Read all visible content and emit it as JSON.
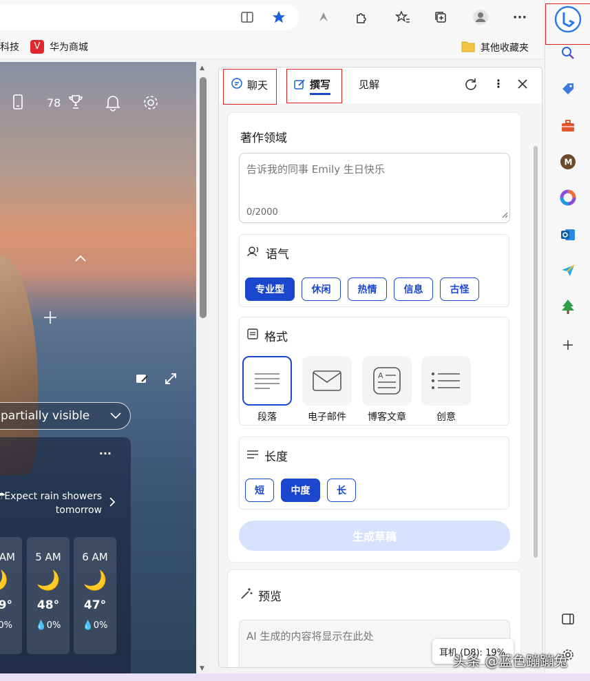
{
  "bookmarks": {
    "item1": "科技",
    "item2": "华为商城",
    "other": "其他收藏夹"
  },
  "ntp": {
    "points": "78",
    "weather_bar": "partially visible",
    "forecast": "Expect rain showers tomorrow",
    "hours": [
      {
        "time": "AM",
        "temp": "9°",
        "rain": "0%"
      },
      {
        "time": "5 AM",
        "temp": "48°",
        "rain": "0%"
      },
      {
        "time": "6 AM",
        "temp": "47°",
        "rain": "0%"
      }
    ],
    "more": "···"
  },
  "copilot": {
    "tabs": {
      "chat": "聊天",
      "compose": "撰写",
      "insights": "见解"
    },
    "compose": {
      "heading": "著作领域",
      "placeholder": "告诉我的同事 Emily 生日快乐",
      "counter": "0/2000",
      "tone": {
        "title": "语气",
        "options": [
          "专业型",
          "休闲",
          "热情",
          "信息",
          "古怪"
        ],
        "selected": "专业型"
      },
      "format": {
        "title": "格式",
        "options": [
          "段落",
          "电子邮件",
          "博客文章",
          "创意"
        ],
        "selected": "段落"
      },
      "length": {
        "title": "长度",
        "options": [
          "短",
          "中度",
          "长"
        ],
        "selected": "中度"
      },
      "generate": "生成草稿",
      "preview_title": "预览",
      "preview_placeholder": "AI 生成的内容将显示在此处"
    }
  },
  "toast": "耳机 (D8): 19%",
  "watermark": "头条 @蓝色蹦蹦兔",
  "colors": {
    "accent": "#1b47cf",
    "highlight_box": "#e02020"
  }
}
